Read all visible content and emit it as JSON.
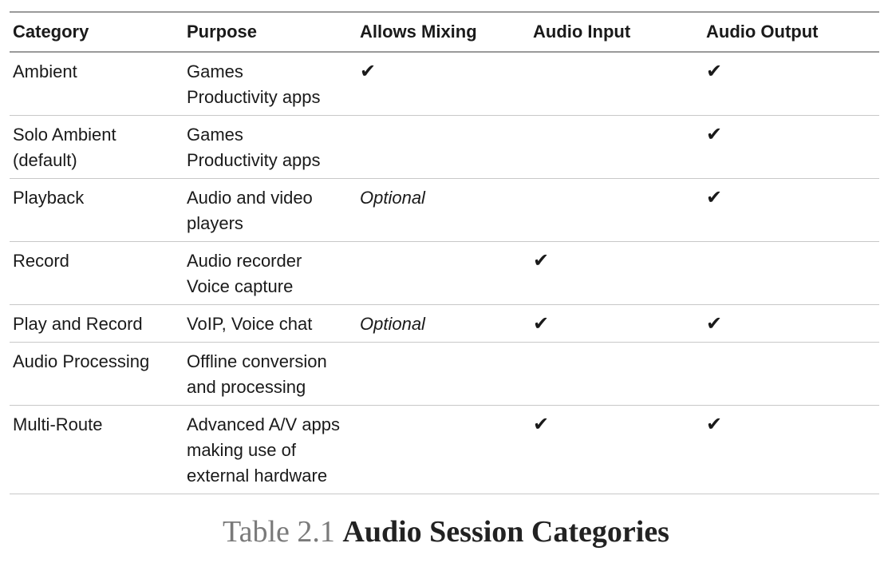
{
  "table": {
    "headers": [
      "Category",
      "Purpose",
      "Allows Mixing",
      "Audio Input",
      "Audio Output"
    ],
    "check_glyph": "✔",
    "rows": [
      {
        "category": [
          "Ambient"
        ],
        "purpose": [
          "Games",
          "Productivity apps"
        ],
        "mixing": "✔",
        "input": "",
        "output": "✔"
      },
      {
        "category": [
          "Solo Ambient",
          "(default)"
        ],
        "purpose": [
          "Games",
          "Productivity apps"
        ],
        "mixing": "",
        "input": "",
        "output": "✔"
      },
      {
        "category": [
          "Playback"
        ],
        "purpose": [
          "Audio and video",
          "players"
        ],
        "mixing": "Optional",
        "input": "",
        "output": "✔"
      },
      {
        "category": [
          "Record"
        ],
        "purpose": [
          "Audio recorder",
          "Voice capture"
        ],
        "mixing": "",
        "input": "✔",
        "output": ""
      },
      {
        "category": [
          "Play and Record"
        ],
        "purpose": [
          "VoIP, Voice chat"
        ],
        "mixing": "Optional",
        "input": "✔",
        "output": "✔"
      },
      {
        "category": [
          "Audio Processing"
        ],
        "purpose": [
          "Offline conversion",
          "and processing"
        ],
        "mixing": "",
        "input": "",
        "output": ""
      },
      {
        "category": [
          "Multi-Route"
        ],
        "purpose": [
          "Advanced A/V apps",
          "making use of",
          "external hardware"
        ],
        "mixing": "",
        "input": "✔",
        "output": "✔"
      }
    ]
  },
  "caption": {
    "number": "Table 2.1",
    "title": "Audio Session Categories"
  }
}
